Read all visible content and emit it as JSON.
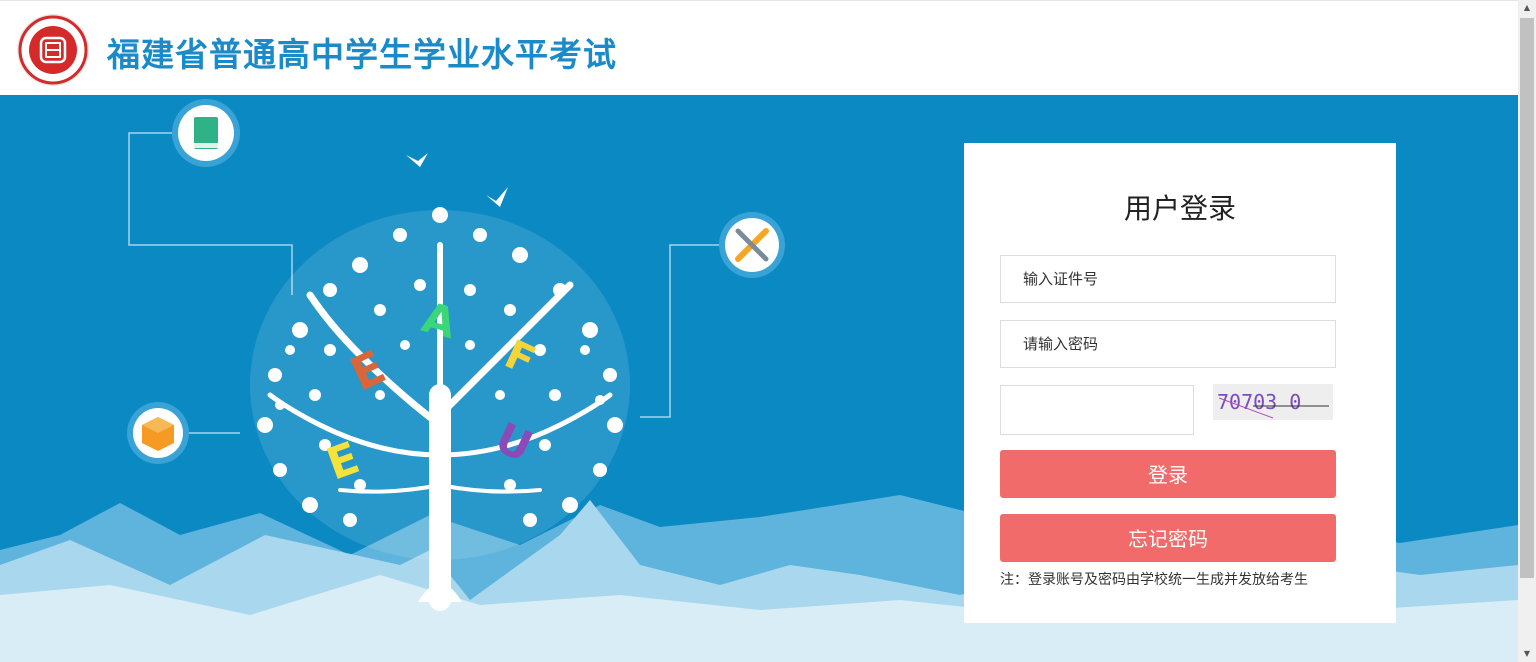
{
  "header": {
    "title": "福建省普通高中学生学业水平考试",
    "logo_icon": "exam-board-seal-icon"
  },
  "banner": {
    "tree_letters": [
      "A",
      "E",
      "F",
      "E",
      "U"
    ],
    "feature_icons": [
      "book-icon",
      "tools-icon",
      "cube-icon"
    ]
  },
  "login": {
    "title": "用户登录",
    "id_placeholder": "输入证件号",
    "password_placeholder": "请输入密码",
    "captcha_value": "",
    "captcha_text": "70703 0",
    "login_label": "登录",
    "forgot_label": "忘记密码",
    "note": "注：登录账号及密码由学校统一生成并发放给考生"
  },
  "colors": {
    "header_title": "#1a8ac8",
    "banner_bg": "#0b89c2",
    "button": "#f26b6b"
  }
}
